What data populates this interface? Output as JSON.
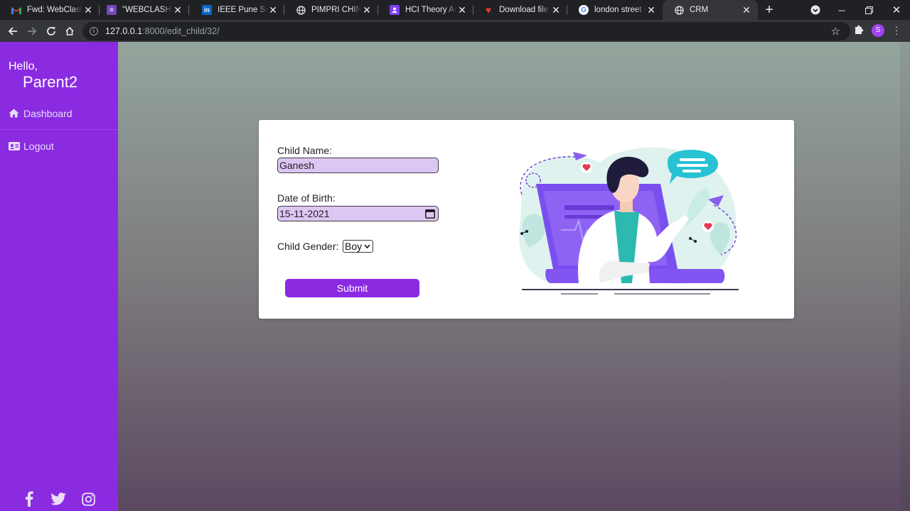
{
  "browser": {
    "tabs": [
      {
        "title": "Fwd: WebClash: F",
        "icon": "gmail-icon"
      },
      {
        "title": "\"WEBCLASH REGI",
        "icon": "forms-icon"
      },
      {
        "title": "IEEE Pune Section",
        "icon": "linkedin-icon"
      },
      {
        "title": "PIMPRI CHINCHW",
        "icon": "globe-icon"
      },
      {
        "title": "HCI Theory Assig",
        "icon": "classroom-icon"
      },
      {
        "title": "Download file | iL",
        "icon": "heart-icon"
      },
      {
        "title": "london street vie",
        "icon": "google-icon"
      },
      {
        "title": "CRM",
        "icon": "globe-icon"
      }
    ],
    "url_host": "127.0.0.1",
    "url_path": ":8000/edit_child/32/",
    "profile_initial": "S"
  },
  "sidebar": {
    "greeting": "Hello,",
    "username": "Parent2",
    "items": [
      {
        "label": "Dashboard",
        "icon": "home-icon"
      },
      {
        "label": "Logout",
        "icon": "id-card-icon"
      }
    ],
    "social": [
      "facebook-icon",
      "twitter-icon",
      "instagram-icon"
    ]
  },
  "form": {
    "name_label": "Child Name:",
    "name_value": "Ganesh",
    "dob_label": "Date of Birth:",
    "dob_value": "15-11-2021",
    "gender_label": "Child Gender:",
    "gender_value": "Boy",
    "submit_label": "Submit"
  },
  "colors": {
    "sidebar": "#8a2be2",
    "input_fill": "#dcc6f3",
    "button": "#8a2be2"
  }
}
